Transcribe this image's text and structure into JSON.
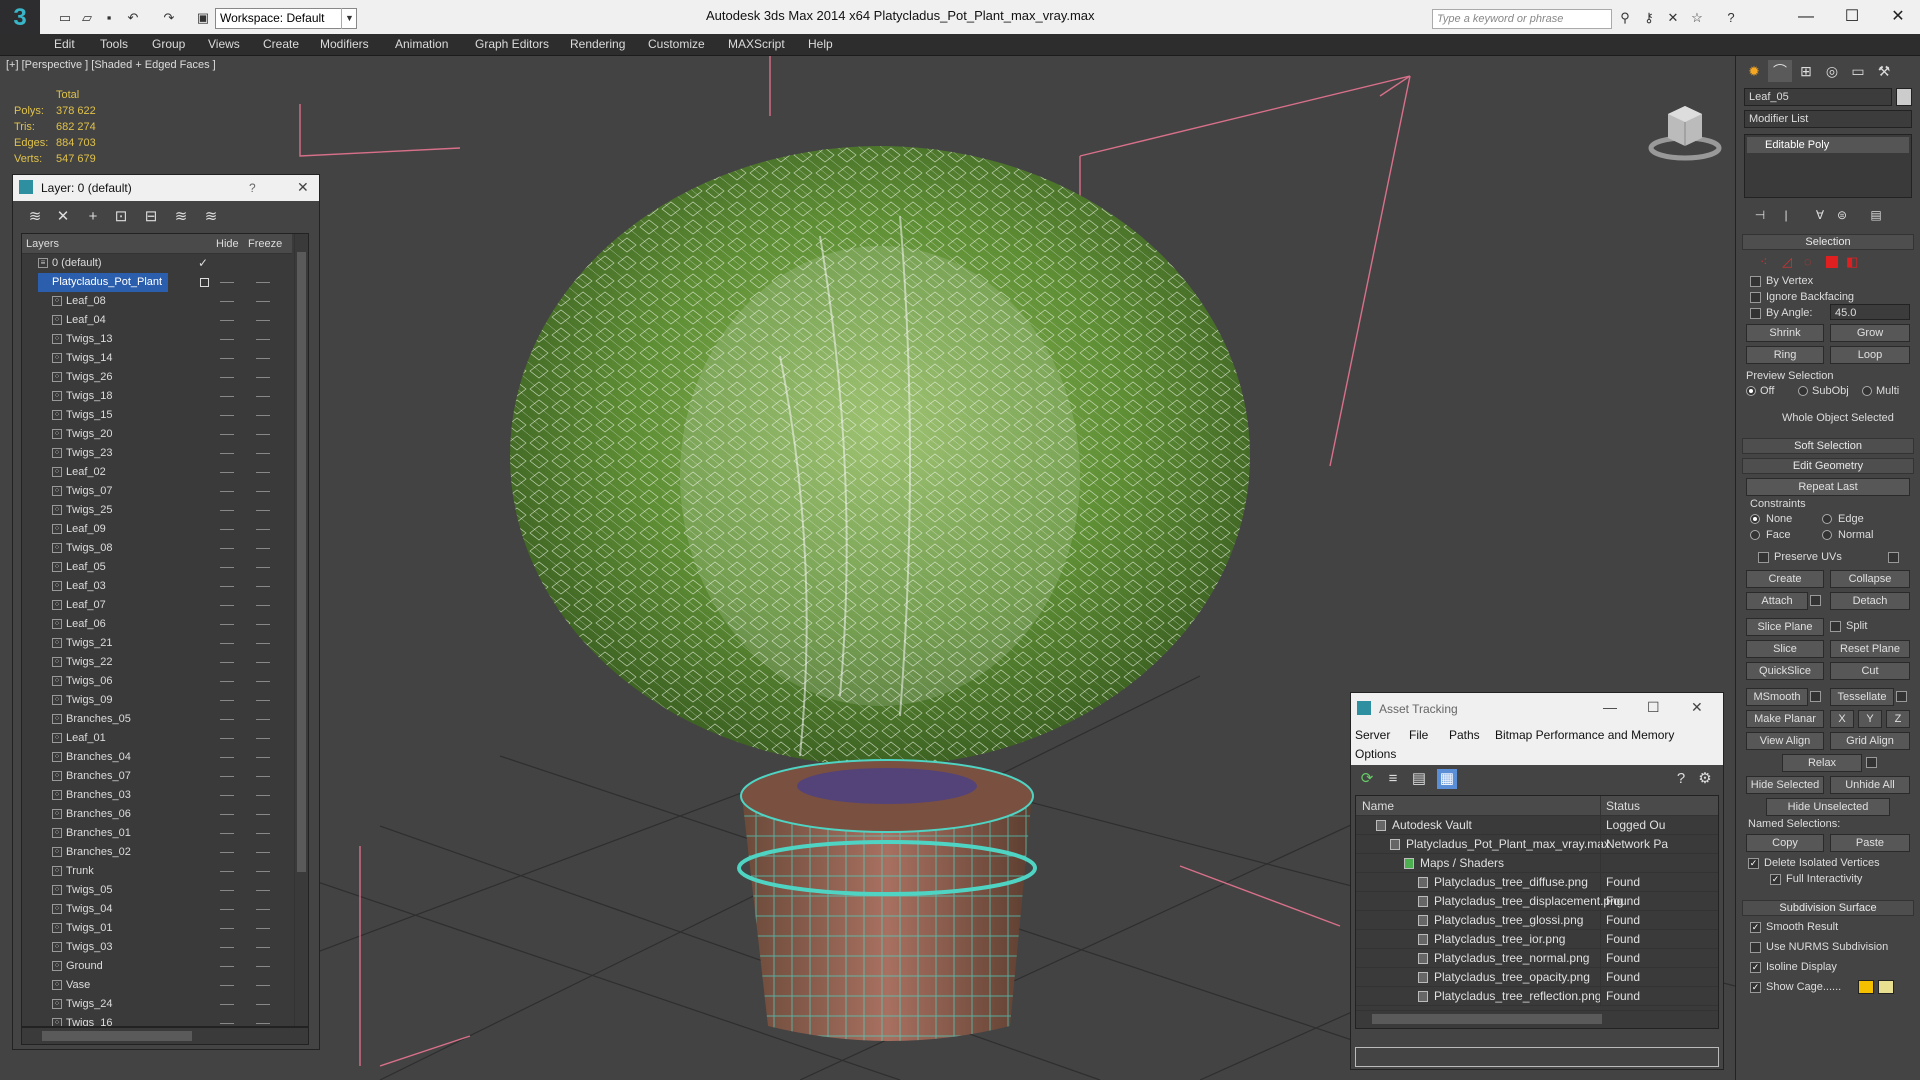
{
  "titlebar": {
    "workspace": "Workspace: Default",
    "app_title": "Autodesk 3ds Max  2014 x64      Platycladus_Pot_Plant_max_vray.max",
    "search_placeholder": "Type a keyword or phrase"
  },
  "menu": [
    "Edit",
    "Tools",
    "Group",
    "Views",
    "Create",
    "Modifiers",
    "Animation",
    "Graph Editors",
    "Rendering",
    "Customize",
    "MAXScript",
    "Help"
  ],
  "viewport": {
    "label": "[+] [Perspective ] [Shaded + Edged Faces ]",
    "stats": {
      "header": "Total",
      "rows": [
        {
          "label": "Polys:",
          "value": "378 622"
        },
        {
          "label": "Tris:",
          "value": "682 274"
        },
        {
          "label": "Edges:",
          "value": "884 703"
        },
        {
          "label": "Verts:",
          "value": "547 679"
        }
      ]
    }
  },
  "layer_panel": {
    "title": "Layer: 0 (default)",
    "help": "?",
    "col_layers": "Layers",
    "col_hide": "Hide",
    "col_freeze": "Freeze",
    "rows": [
      {
        "name": "0 (default)",
        "level": 0,
        "checked": true
      },
      {
        "name": "Platycladus_Pot_Plant",
        "level": 0,
        "selected": true
      },
      {
        "name": "Leaf_08",
        "level": 1
      },
      {
        "name": "Leaf_04",
        "level": 1
      },
      {
        "name": "Twigs_13",
        "level": 1
      },
      {
        "name": "Twigs_14",
        "level": 1
      },
      {
        "name": "Twigs_26",
        "level": 1
      },
      {
        "name": "Twigs_18",
        "level": 1
      },
      {
        "name": "Twigs_15",
        "level": 1
      },
      {
        "name": "Twigs_20",
        "level": 1
      },
      {
        "name": "Twigs_23",
        "level": 1
      },
      {
        "name": "Leaf_02",
        "level": 1
      },
      {
        "name": "Twigs_07",
        "level": 1
      },
      {
        "name": "Twigs_25",
        "level": 1
      },
      {
        "name": "Leaf_09",
        "level": 1
      },
      {
        "name": "Twigs_08",
        "level": 1
      },
      {
        "name": "Leaf_05",
        "level": 1
      },
      {
        "name": "Leaf_03",
        "level": 1
      },
      {
        "name": "Leaf_07",
        "level": 1
      },
      {
        "name": "Leaf_06",
        "level": 1
      },
      {
        "name": "Twigs_21",
        "level": 1
      },
      {
        "name": "Twigs_22",
        "level": 1
      },
      {
        "name": "Twigs_06",
        "level": 1
      },
      {
        "name": "Twigs_09",
        "level": 1
      },
      {
        "name": "Branches_05",
        "level": 1
      },
      {
        "name": "Leaf_01",
        "level": 1
      },
      {
        "name": "Branches_04",
        "level": 1
      },
      {
        "name": "Branches_07",
        "level": 1
      },
      {
        "name": "Branches_03",
        "level": 1
      },
      {
        "name": "Branches_06",
        "level": 1
      },
      {
        "name": "Branches_01",
        "level": 1
      },
      {
        "name": "Branches_02",
        "level": 1
      },
      {
        "name": "Trunk",
        "level": 1
      },
      {
        "name": "Twigs_05",
        "level": 1
      },
      {
        "name": "Twigs_04",
        "level": 1
      },
      {
        "name": "Twigs_01",
        "level": 1
      },
      {
        "name": "Twigs_03",
        "level": 1
      },
      {
        "name": "Ground",
        "level": 1
      },
      {
        "name": "Vase",
        "level": 1
      },
      {
        "name": "Twigs_24",
        "level": 1
      },
      {
        "name": "Twigs_16",
        "level": 1
      }
    ]
  },
  "asset_panel": {
    "title": "Asset Tracking",
    "menu": [
      "Server",
      "File",
      "Paths",
      "Bitmap Performance and Memory",
      "Options"
    ],
    "col_name": "Name",
    "col_status": "Status",
    "rows": [
      {
        "name": "Autodesk Vault",
        "status": "Logged Ou",
        "indent": 1
      },
      {
        "name": "Platycladus_Pot_Plant_max_vray.max",
        "status": "Network Pa",
        "indent": 2
      },
      {
        "name": "Maps / Shaders",
        "status": "",
        "indent": 3
      },
      {
        "name": "Platycladus_tree_diffuse.png",
        "status": "Found",
        "indent": 4
      },
      {
        "name": "Platycladus_tree_displacement.png",
        "status": "Found",
        "indent": 4
      },
      {
        "name": "Platycladus_tree_glossi.png",
        "status": "Found",
        "indent": 4
      },
      {
        "name": "Platycladus_tree_ior.png",
        "status": "Found",
        "indent": 4
      },
      {
        "name": "Platycladus_tree_normal.png",
        "status": "Found",
        "indent": 4
      },
      {
        "name": "Platycladus_tree_opacity.png",
        "status": "Found",
        "indent": 4
      },
      {
        "name": "Platycladus_tree_reflection.png",
        "status": "Found",
        "indent": 4
      }
    ]
  },
  "command_panel": {
    "object_name": "Leaf_05",
    "modifier_list": "Modifier List",
    "stack_item": "Editable Poly",
    "selection": {
      "title": "Selection",
      "by_vertex": "By Vertex",
      "ignore_backfacing": "Ignore Backfacing",
      "by_angle": "By Angle:",
      "angle_value": "45.0",
      "shrink": "Shrink",
      "grow": "Grow",
      "ring": "Ring",
      "loop": "Loop",
      "preview_title": "Preview Selection",
      "off": "Off",
      "subobj": "SubObj",
      "multi": "Multi",
      "whole": "Whole Object Selected"
    },
    "soft_selection": "Soft Selection",
    "edit_geometry": {
      "title": "Edit Geometry",
      "repeat_last": "Repeat Last",
      "constraints": "Constraints",
      "none": "None",
      "edge": "Edge",
      "face": "Face",
      "normal": "Normal",
      "preserve_uvs": "Preserve UVs",
      "create": "Create",
      "collapse": "Collapse",
      "attach": "Attach",
      "detach": "Detach",
      "slice_plane": "Slice Plane",
      "split": "Split",
      "slice": "Slice",
      "reset_plane": "Reset Plane",
      "quickslice": "QuickSlice",
      "cut": "Cut",
      "msmooth": "MSmooth",
      "tessellate": "Tessellate",
      "make_planar": "Make Planar",
      "x": "X",
      "y": "Y",
      "z": "Z",
      "view_align": "View Align",
      "grid_align": "Grid Align",
      "relax": "Relax",
      "hide_selected": "Hide Selected",
      "unhide_all": "Unhide All",
      "hide_unselected": "Hide Unselected",
      "named_selections": "Named Selections:",
      "copy": "Copy",
      "paste": "Paste",
      "delete_isolated": "Delete Isolated Vertices",
      "full_interactivity": "Full Interactivity"
    },
    "subdivision": {
      "title": "Subdivision Surface",
      "smooth_result": "Smooth Result",
      "use_nurms": "Use NURMS Subdivision",
      "isoline": "Isoline Display",
      "show_cage": "Show Cage......"
    }
  },
  "colors": {
    "accent_blue": "#2b5fae",
    "stat_yellow": "#e0c24a",
    "vertex_red": "#e02020",
    "wire_cyan": "#4fd4c4"
  }
}
